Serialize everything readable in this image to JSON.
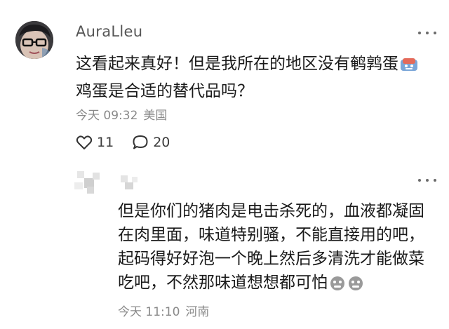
{
  "comment": {
    "username": "AuraLleu",
    "text_lines": [
      "这看起来真好！但是我所在的地区没有鹌鹑蛋",
      "鸡蛋是合适的替代品吗？"
    ],
    "time": "今天 09:32",
    "location": "美国",
    "likes": "11",
    "replies": "20"
  },
  "reply": {
    "text_lines": [
      "但是你们的猪肉是电击杀死的，血液都凝固",
      "在肉里面，味道特别骚，不能直接用的吧，",
      "起码得好好泡一个晚上然后多清洗才能做菜",
      "吃吧，不然那味道想想都可怕"
    ],
    "time": "今天 11:10",
    "location": "河南"
  },
  "icons": {
    "more": "more-dots-icon",
    "like": "heart-outline-icon",
    "comment": "speech-bubble-icon",
    "emoji1": "sweat-smile-emoji-icon",
    "emoji2": "grimace-emoji-icon"
  },
  "colors": {
    "meta_text": "#8a8a8a",
    "username": "#555555"
  }
}
